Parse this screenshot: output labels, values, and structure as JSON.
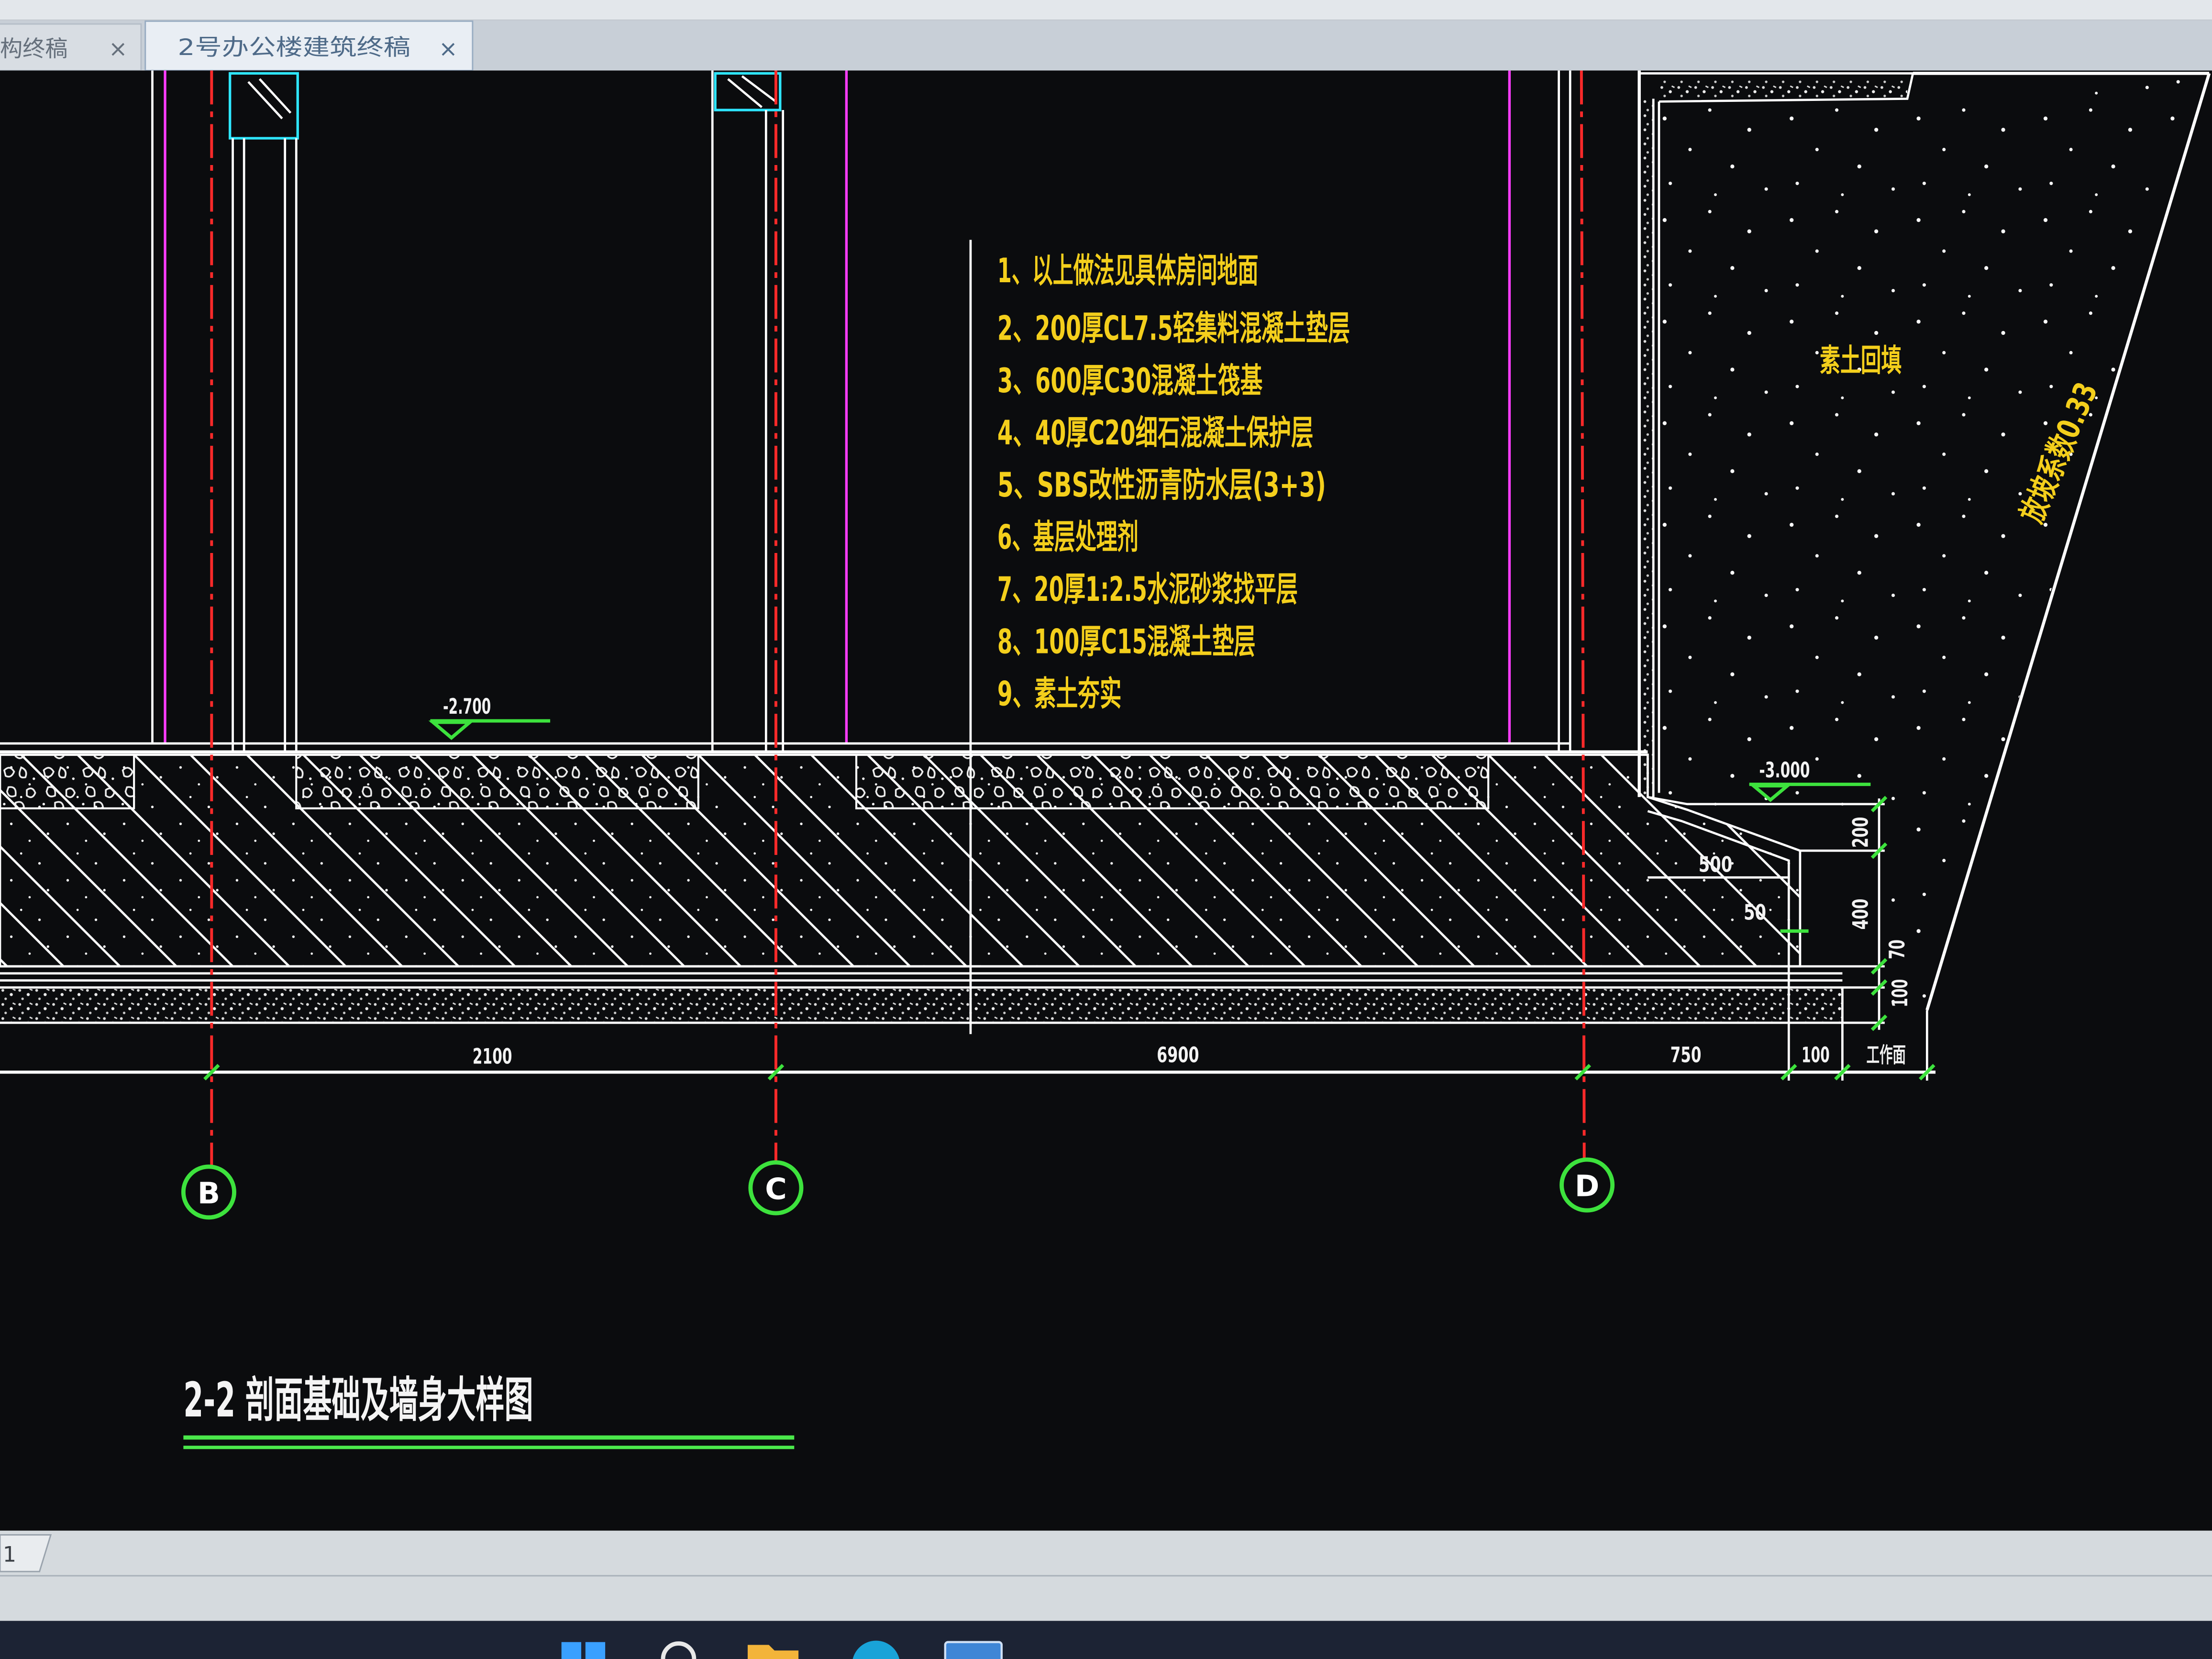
{
  "app": {
    "tabs": [
      {
        "label": "构终稿",
        "close": "×"
      },
      {
        "label": "2号办公楼建筑终稿",
        "close": "×"
      }
    ],
    "layout_tab": "1"
  },
  "drawing": {
    "notes": [
      "1、以上做法见具体房间地面",
      "2、200厚CL7.5轻集料混凝土垫层",
      "3、600厚C30混凝土筏基",
      "4、40厚C20细石混凝土保护层",
      "5、SBS改性沥青防水层(3+3)",
      "6、基层处理剂",
      "7、20厚1:2.5水泥砂浆找平层",
      "8、100厚C15混凝土垫层",
      "9、素土夯实"
    ],
    "backfill_label": "素土回填",
    "slope_label": "放坡系数0.33",
    "elevations": {
      "floor": "-2.700",
      "pit": "-3.000"
    },
    "dims": {
      "bottom": [
        "2100",
        "6900",
        "750",
        "100",
        "工作面"
      ],
      "step": [
        "500",
        "50"
      ],
      "vertical": [
        "200",
        "400",
        "70",
        "100"
      ]
    },
    "axes": [
      "B",
      "C",
      "D"
    ],
    "title": "2-2 剖面基础及墙身大样图"
  },
  "colors": {
    "notes_text": "#f4cf1c",
    "line": "#ffffff",
    "wall": "#ff3cff",
    "column": "#2ee6ff",
    "axis": "#ff2a2a",
    "green": "#3de23d"
  },
  "taskbar": {
    "icons": [
      "windows-start-icon",
      "search-icon",
      "folder-icon",
      "edge-browser-icon",
      "app-window-icon"
    ]
  }
}
